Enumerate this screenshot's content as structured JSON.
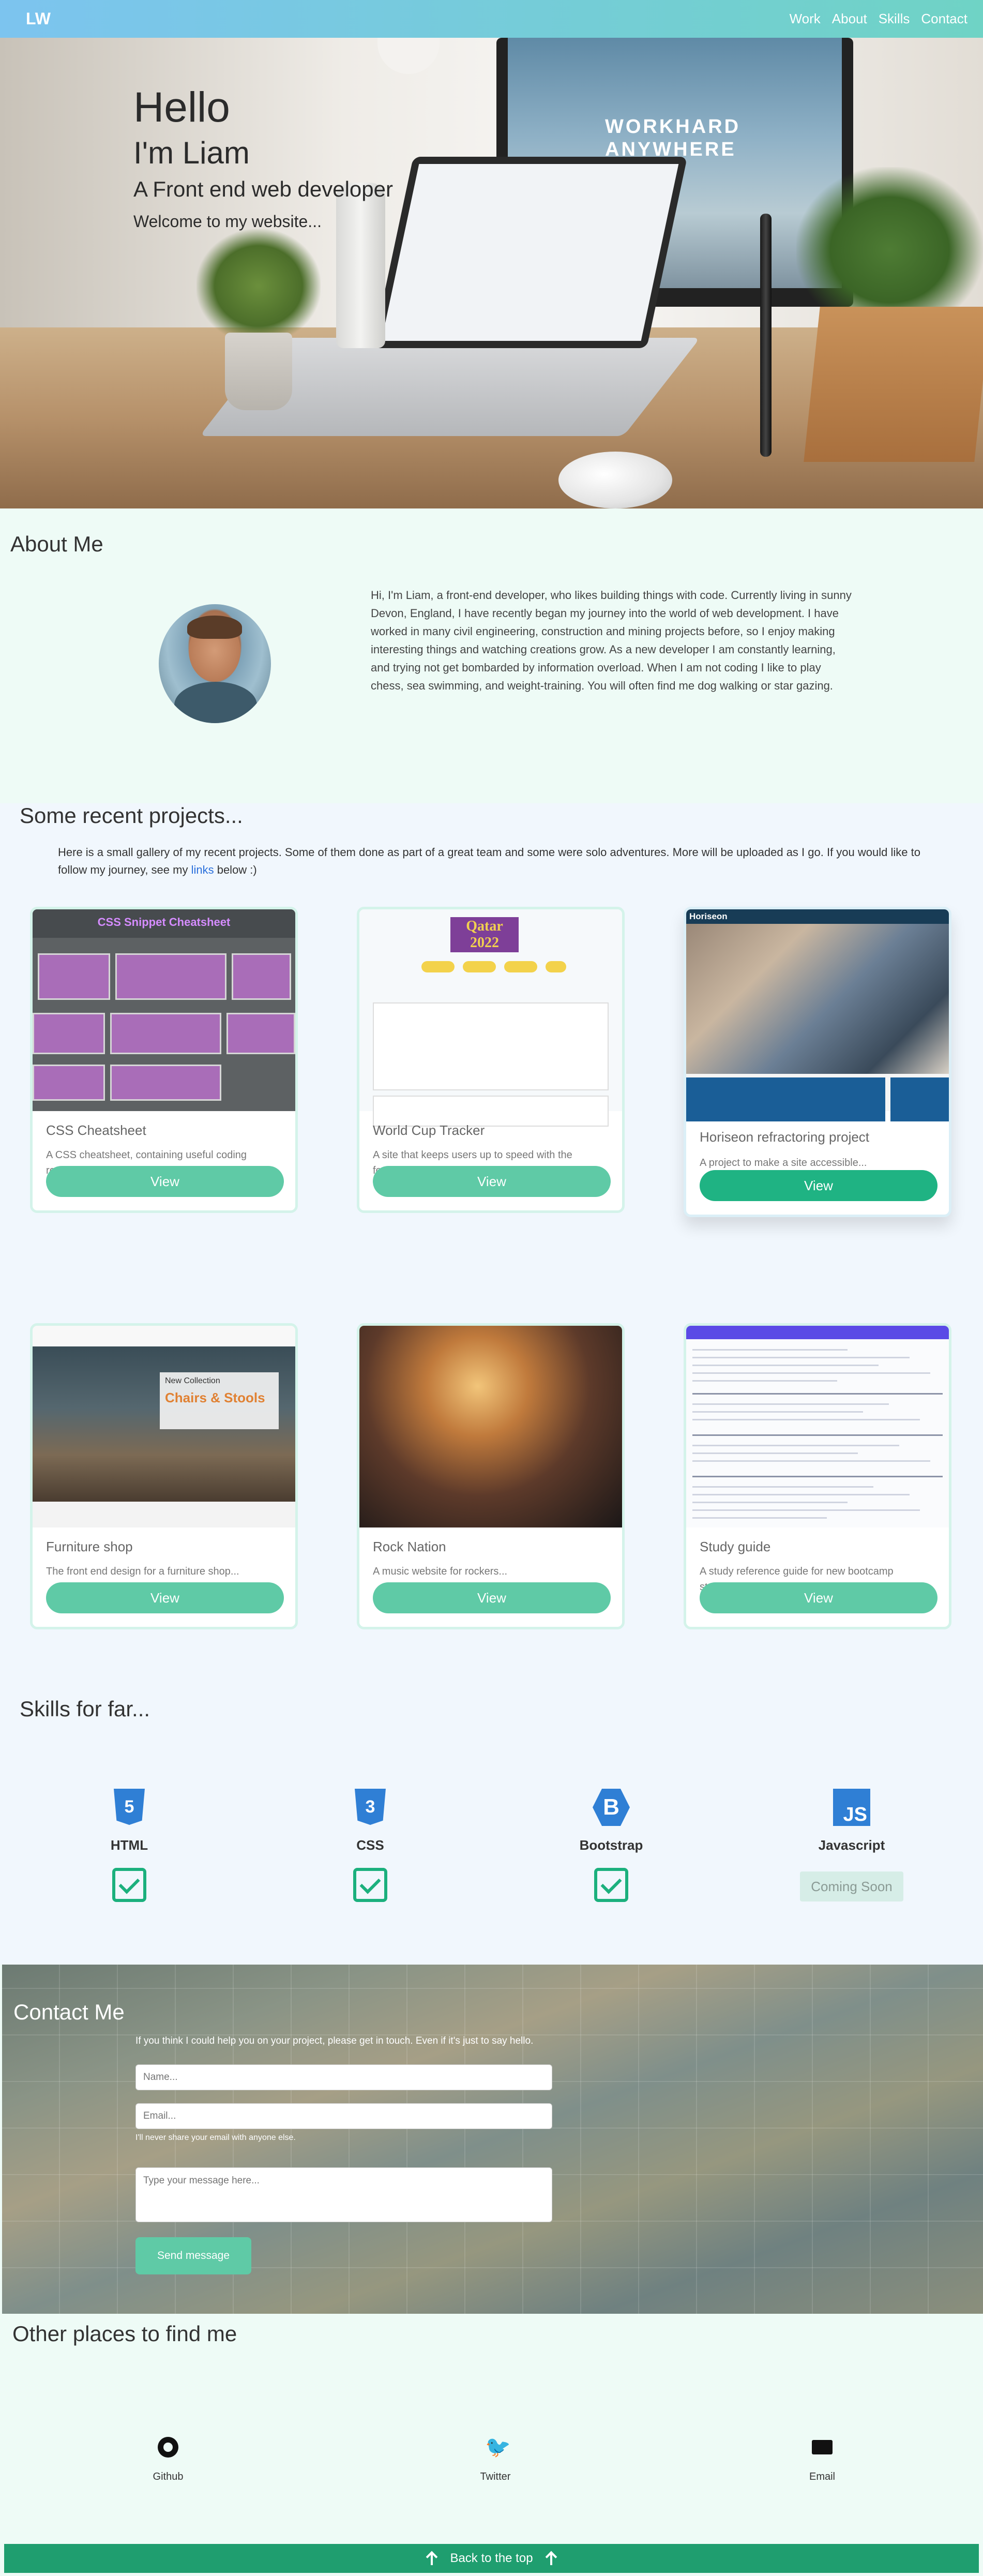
{
  "nav": {
    "brand": "LW",
    "links": [
      "Work",
      "About",
      "Skills",
      "Contact"
    ]
  },
  "hero": {
    "heading": "Hello",
    "name": "I'm Liam",
    "role": "A Front end web developer",
    "welcome": "Welcome to my website...",
    "monitor_text_1": "WORKHARD",
    "monitor_text_2": "ANYWHERE"
  },
  "about": {
    "title": "About Me",
    "bio": "Hi, I'm Liam, a front-end developer, who likes building things with code. Currently living in sunny Devon, England, I have recently began my journey into the world of web development. I have worked in many civil engineering, construction and mining projects before, so I enjoy making interesting things and watching creations grow. As a new developer I am constantly learning, and trying not get bombarded by information overload. When I am not coding I like to play chess, sea swimming, and weight-training. You will often find me dog walking or star gazing."
  },
  "projects": {
    "title": "Some recent projects...",
    "intro_before_link": "Here is a small gallery of my recent projects. Some of them done as part of a great team and some were solo adventures. More will be uploaded as I go. If you would like to follow my journey, see my ",
    "intro_link": "links",
    "intro_after_link": " below :)",
    "items": [
      {
        "title": "CSS Cheatsheet",
        "description": "A CSS cheatsheet, containing useful coding reminders...",
        "button": "View",
        "thumb_title": "CSS Snippet Cheatsheet"
      },
      {
        "title": "World Cup Tracker",
        "description": "A site that keeps users up to speed with the football...",
        "button": "View",
        "thumb_title": "Qatar 2022"
      },
      {
        "title": "Horiseon refractoring project",
        "description": "A project to make a site accessible...",
        "button": "View",
        "thumb_title": "Horiseon"
      },
      {
        "title": "Furniture shop",
        "description": "The front end design for a furniture shop...",
        "button": "View",
        "thumb_title": "New Collection",
        "thumb_subtitle": "Chairs & Stools"
      },
      {
        "title": "Rock Nation",
        "description": "A music website for rockers...",
        "button": "View"
      },
      {
        "title": "Study guide",
        "description": "A study reference guide for new bootcamp students...",
        "button": "View"
      }
    ]
  },
  "skills": {
    "title": "Skills for far...",
    "items": [
      {
        "name": "HTML",
        "icon": "html5-icon",
        "status": "done"
      },
      {
        "name": "CSS",
        "icon": "css3-icon",
        "status": "done"
      },
      {
        "name": "Bootstrap",
        "icon": "bootstrap-icon",
        "status": "done"
      },
      {
        "name": "Javascript",
        "icon": "javascript-icon",
        "status": "Coming Soon"
      }
    ]
  },
  "contact": {
    "title": "Contact Me",
    "lead": "If you think I could help you on your project, please get in touch. Even if it's just to say hello.",
    "name_placeholder": "Name...",
    "email_placeholder": "Email...",
    "email_hint": "I'll never share your email with anyone else.",
    "message_placeholder": "Type your message here...",
    "send_label": "Send message"
  },
  "findme": {
    "title": "Other places to find me",
    "links": [
      {
        "label": "Github",
        "icon": "github-icon"
      },
      {
        "label": "Twitter",
        "icon": "twitter-icon"
      },
      {
        "label": "Email",
        "icon": "email-icon"
      }
    ]
  },
  "footer": {
    "back_to_top": "Back to the top"
  },
  "colors": {
    "accent": "#5fcaa6",
    "accent_dark": "#1f9e6f",
    "nav_start": "#7cc4ef",
    "nav_end": "#6fd3c5"
  }
}
